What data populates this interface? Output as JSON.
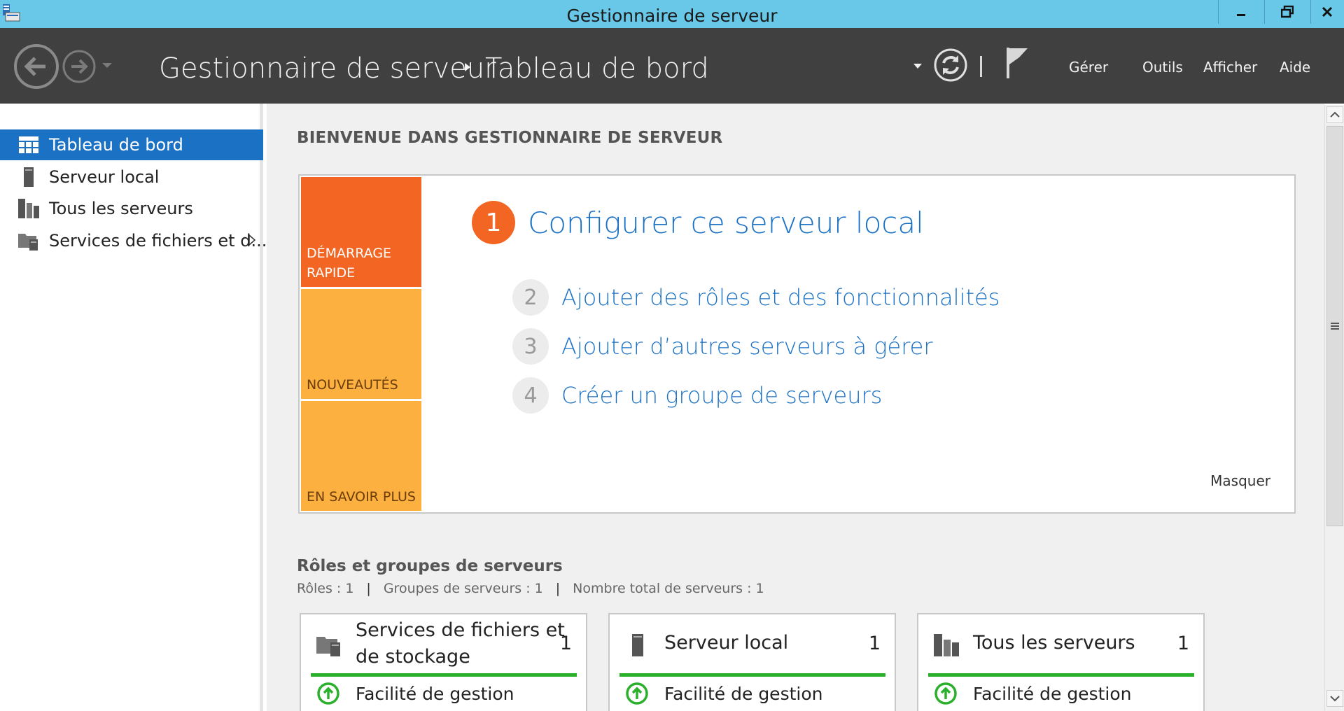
{
  "window": {
    "title": "Gestionnaire de serveur",
    "title_color": "#69c8e8"
  },
  "header": {
    "breadcrumb_root": "Gestionnaire de serveur",
    "breadcrumb_current": "Tableau de bord",
    "menu": {
      "manage": "Gérer",
      "tools": "Outils",
      "view": "Afficher",
      "help": "Aide"
    }
  },
  "sidebar": {
    "items": [
      {
        "label": "Tableau de bord",
        "icon": "dashboard-icon",
        "active": true
      },
      {
        "label": "Serveur local",
        "icon": "server-icon",
        "active": false
      },
      {
        "label": "Tous les serveurs",
        "icon": "servers-icon",
        "active": false
      },
      {
        "label": "Services de fichiers et d...",
        "icon": "file-services-icon",
        "active": false
      }
    ]
  },
  "main": {
    "welcome_title": "BIENVENUE DANS GESTIONNAIRE DE SERVEUR",
    "tiles": {
      "quick_start": "DÉMARRAGE RAPIDE",
      "whats_new": "NOUVEAUTÉS",
      "learn_more": "EN SAVOIR PLUS"
    },
    "steps": [
      {
        "num": "1",
        "label": "Configurer ce serveur local"
      },
      {
        "num": "2",
        "label": "Ajouter des rôles et des fonctionnalités"
      },
      {
        "num": "3",
        "label": "Ajouter d’autres serveurs à gérer"
      },
      {
        "num": "4",
        "label": "Créer un groupe de serveurs"
      }
    ],
    "hide_label": "Masquer",
    "roles": {
      "title": "Rôles et groupes de serveurs",
      "roles_count": "Rôles : 1",
      "groups_count": "Groupes de serveurs : 1",
      "total_servers": "Nombre total de serveurs : 1",
      "separator": "|"
    },
    "cards": [
      {
        "title_line1": "Services de fichiers et",
        "title_line2": "de stockage",
        "count": "1",
        "status": "Facilité de gestion"
      },
      {
        "title_line1": "Serveur local",
        "count": "1",
        "status": "Facilité de gestion"
      },
      {
        "title_line1": "Tous les serveurs",
        "count": "1",
        "status": "Facilité de gestion"
      }
    ]
  },
  "colors": {
    "accent_blue": "#1b72c4",
    "orange": "#f26522",
    "amber": "#fbb040",
    "status_green": "#2bb02b",
    "header_bg": "#404040"
  }
}
